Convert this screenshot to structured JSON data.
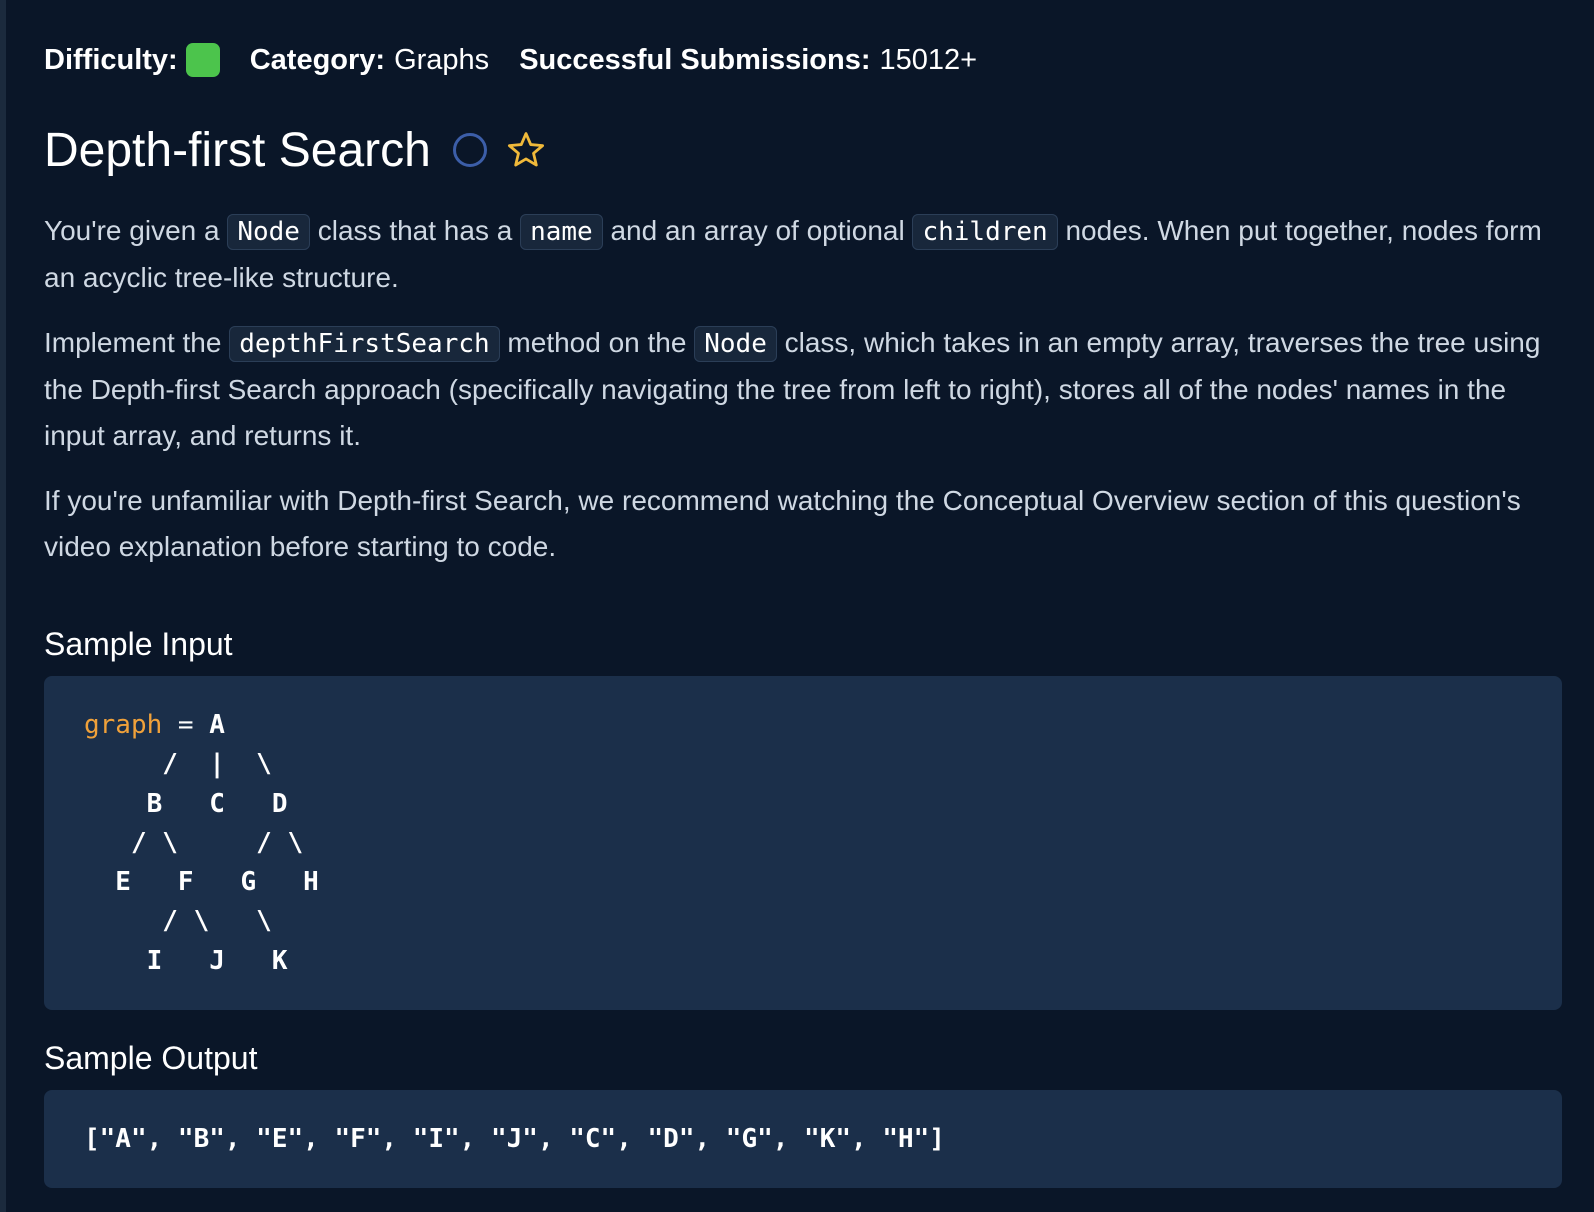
{
  "meta": {
    "difficulty_label": "Difficulty:",
    "difficulty_color": "#4cc44c",
    "category_label": "Category:",
    "category_value": "Graphs",
    "submissions_label": "Successful Submissions:",
    "submissions_value": "15012+"
  },
  "title": "Depth-first Search",
  "icons": {
    "status": "circle-outline-icon",
    "favorite": "star-outline-icon",
    "status_color": "#3c5ea8",
    "favorite_color": "#f0b93a"
  },
  "description": {
    "p1": {
      "t1": "You're given a ",
      "c1": "Node",
      "t2": " class that has a ",
      "c2": "name",
      "t3": " and an array of optional ",
      "c3": "children",
      "t4": " nodes. When put together, nodes form an acyclic tree-like structure."
    },
    "p2": {
      "t1": "Implement the ",
      "c1": "depthFirstSearch",
      "t2": " method on the ",
      "c2": "Node",
      "t3": " class, which takes in an empty array, traverses the tree using the Depth-first Search approach (specifically navigating the tree from left to right), stores all of the nodes' names in the input array, and returns it."
    },
    "p3": "If you're unfamiliar with Depth-first Search, we recommend watching the Conceptual Overview section of this question's video explanation before starting to code."
  },
  "sample_input": {
    "heading": "Sample Input",
    "var_name": "graph",
    "operator": " = ",
    "first_line_rest": "A",
    "diagram_lines": "     /  |  \\\n    B   C   D\n   / \\     / \\\n  E   F   G   H\n     / \\   \\\n    I   J   K"
  },
  "sample_output": {
    "heading": "Sample Output",
    "value": "[\"A\", \"B\", \"E\", \"F\", \"I\", \"J\", \"C\", \"D\", \"G\", \"K\", \"H\"]"
  }
}
